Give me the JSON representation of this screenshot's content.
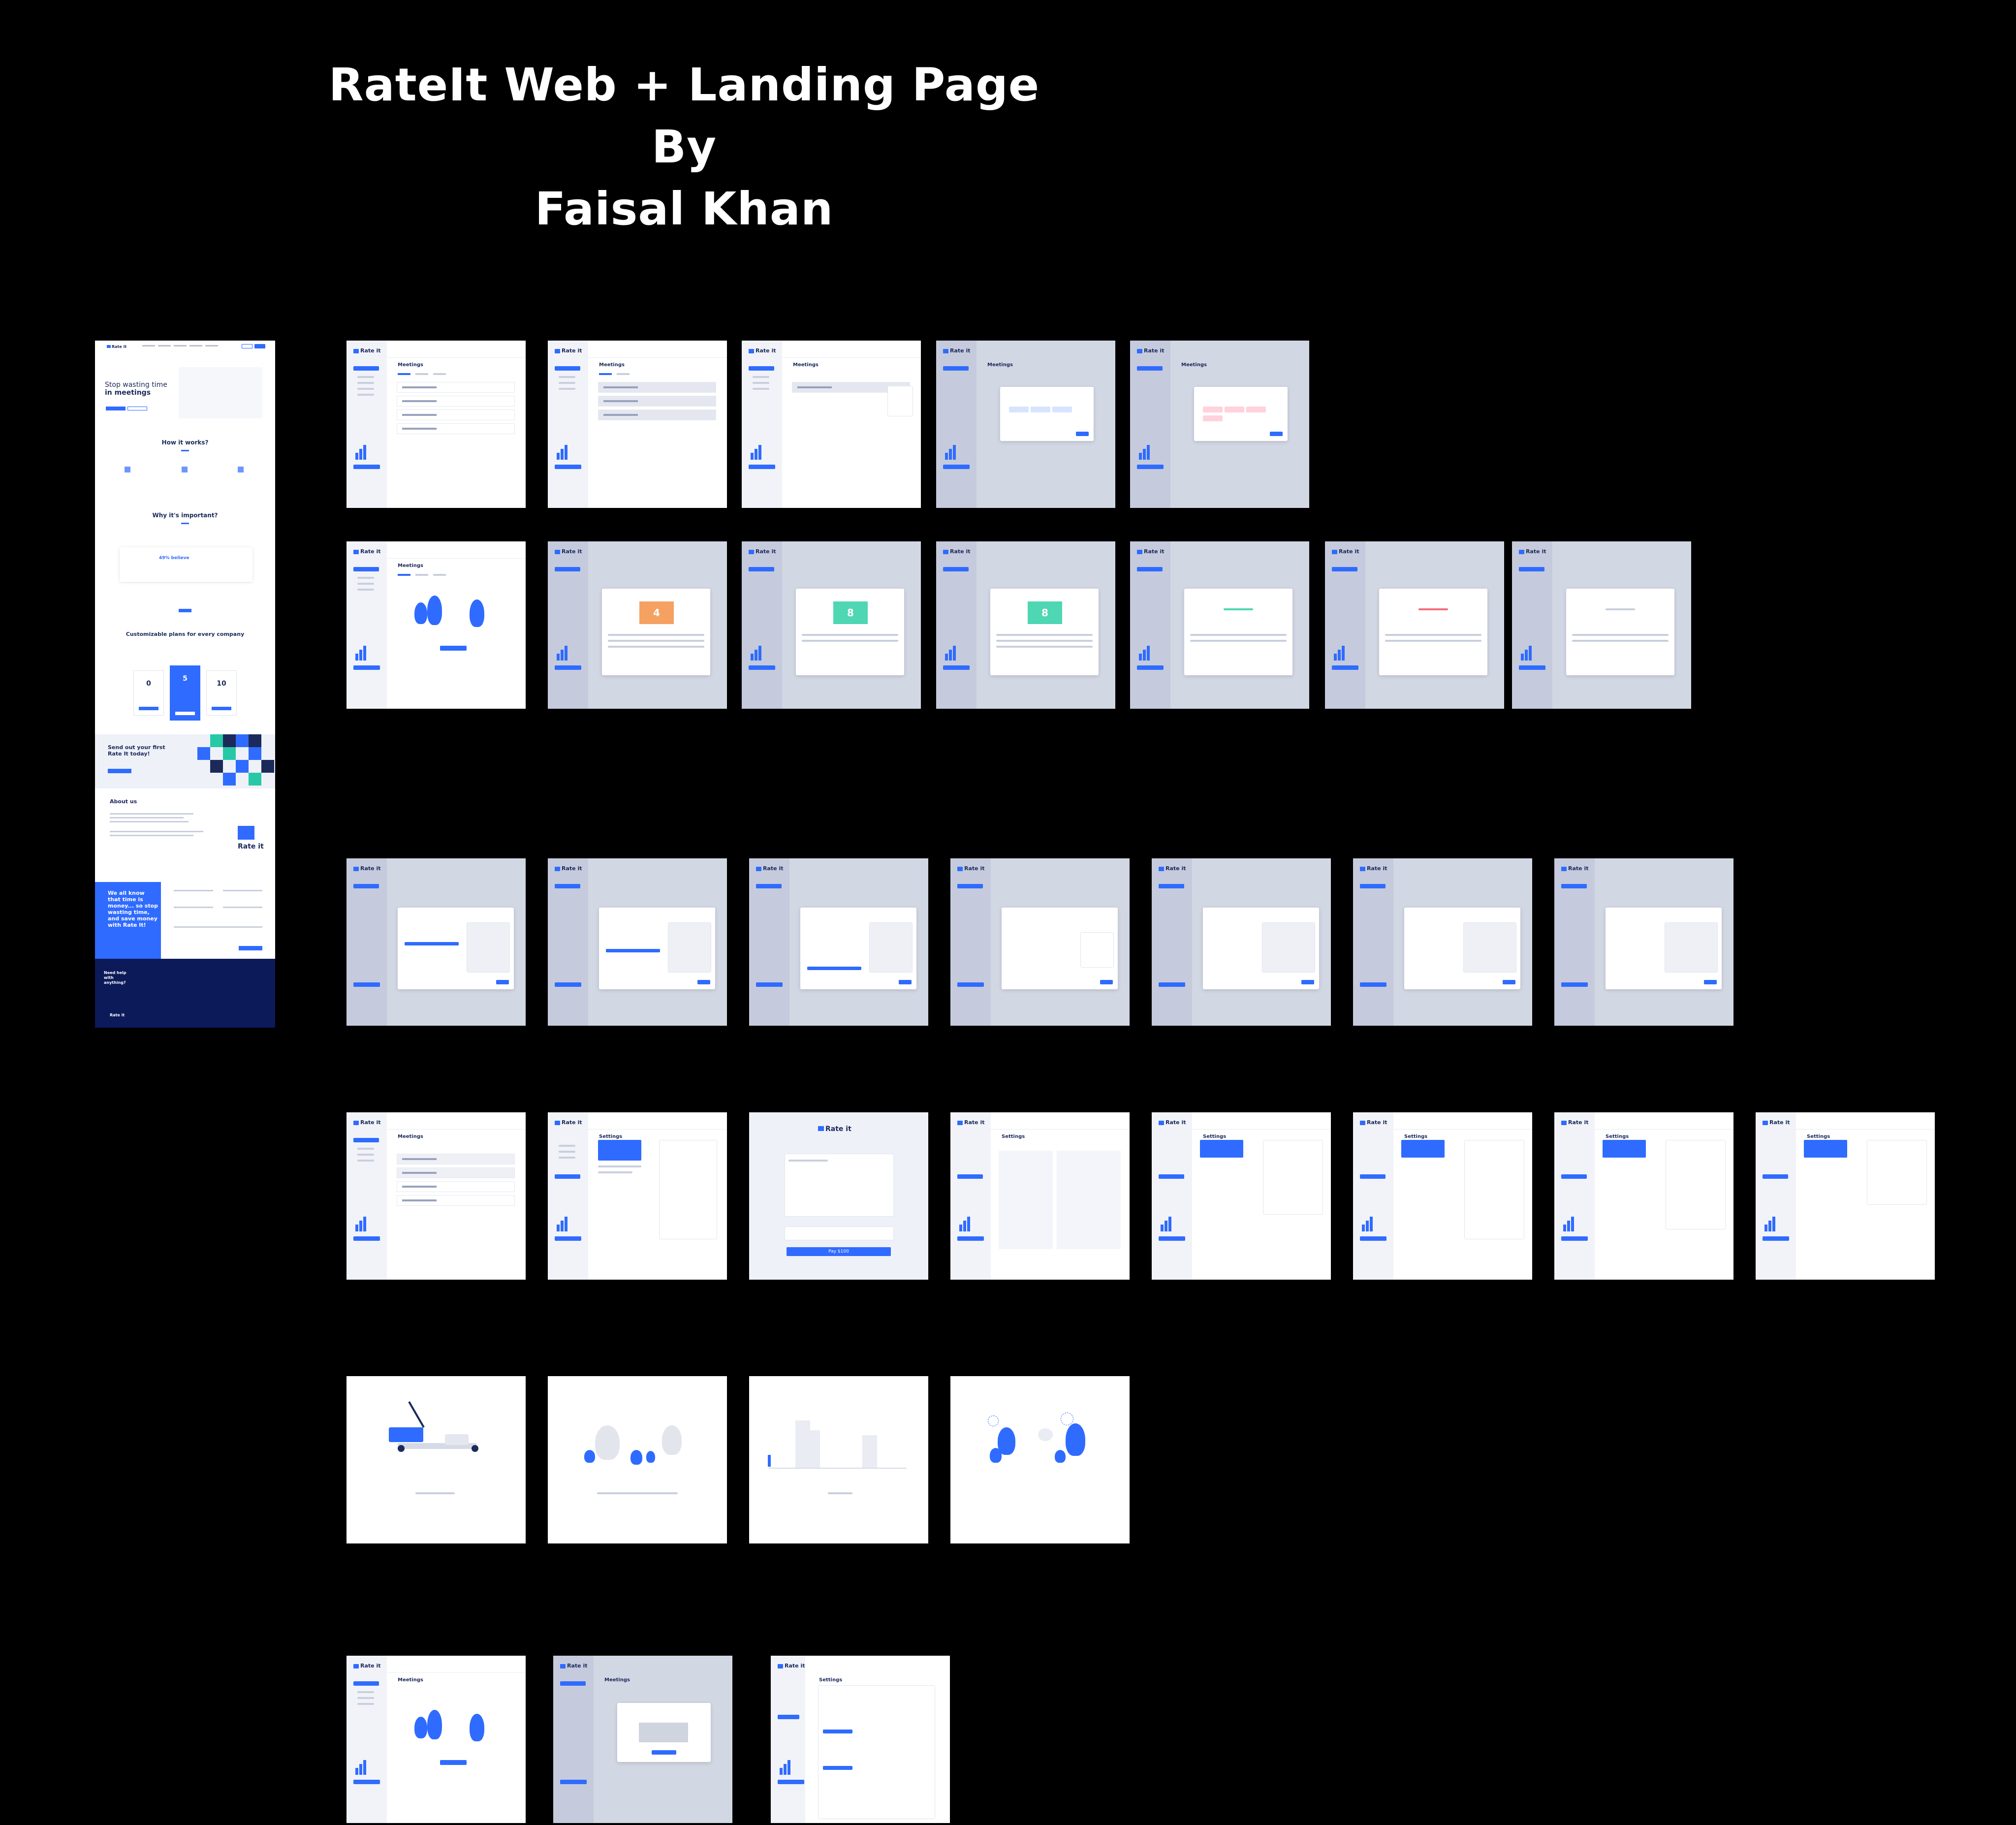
{
  "title": {
    "line1": "RateIt Web + Landing Page",
    "line2": "By",
    "line3": "Faisal Khan"
  },
  "colors": {
    "background": "#000000",
    "accent": "#2f6bff",
    "navy": "#1b2a5a",
    "dimmed_overlay": "#d2d7e4",
    "orange_card": "#f5a162",
    "teal_card": "#4fd6b2"
  },
  "landing": {
    "logo": "Rate it",
    "hero_line1": "Stop wasting time",
    "hero_line2": "in meetings",
    "how_title": "How it works?",
    "why_title": "Why it's important?",
    "stat": "49% believe",
    "plans_title": "Customizable plans for every company",
    "plans": [
      "0",
      "5",
      "10"
    ],
    "cta_line1": "Send out your first",
    "cta_line2": "Rate It today!",
    "about_title": "About us",
    "about_logo": "Rate it",
    "contact_text": "We all know that time is money... so stop wasting time, and save money with Rate It!",
    "footer_help": "Need help with anything?",
    "footer_logo": "Rate it"
  },
  "app": {
    "logo": "Rate it",
    "meetings_heading": "Meetings",
    "settings_heading": "Settings",
    "card_value_a": "4",
    "card_value_b": "8",
    "payment_logo": "Rate it",
    "pay_button": "Pay $100"
  }
}
